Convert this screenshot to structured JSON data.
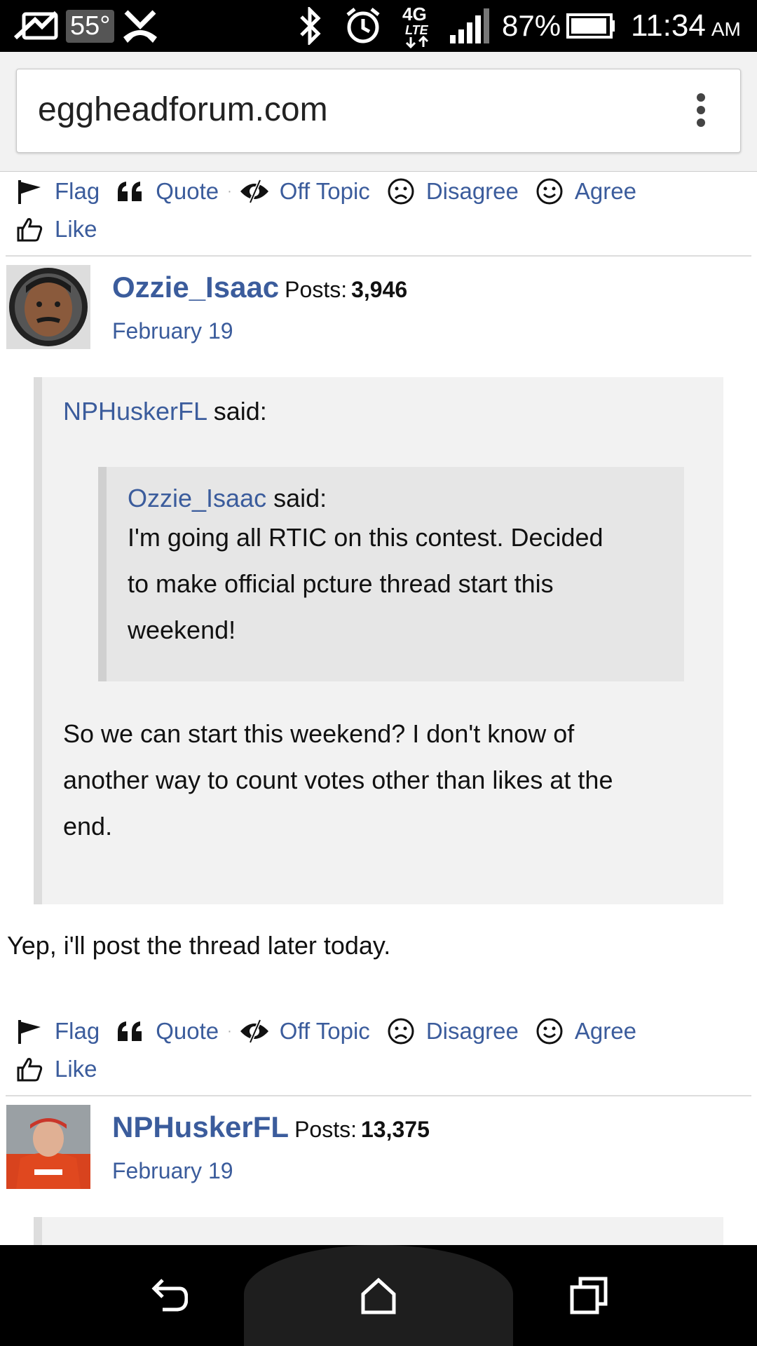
{
  "status_bar": {
    "temperature": "55°",
    "battery_percent": "87%",
    "network": "4G LTE",
    "time": "11:34",
    "ampm": "AM"
  },
  "browser": {
    "url": "eggheadforum.com"
  },
  "actions": {
    "flag": "Flag",
    "quote": "Quote",
    "off_topic": "Off Topic",
    "disagree": "Disagree",
    "agree": "Agree",
    "like": "Like"
  },
  "posts": [
    {
      "author": "Ozzie_Isaac",
      "posts_label": "Posts:",
      "posts_count": "3,946",
      "date": "February 19",
      "quote": {
        "author": "NPHuskerFL",
        "said": "said:",
        "nested": {
          "author": "Ozzie_Isaac",
          "said": "said:",
          "lines": [
            "I'm going all RTIC on this contest.  Decided",
            "to make official pcture thread start this",
            "weekend!"
          ]
        },
        "lines": [
          "So we can start this weekend?  I don't know of",
          "another way to count votes other than likes at the",
          "end."
        ]
      },
      "reply": "Yep, i'll post the thread later today."
    },
    {
      "author": "NPHuskerFL",
      "posts_label": "Posts:",
      "posts_count": "13,375",
      "date": "February 19"
    }
  ],
  "icons": {
    "flag": "flag-icon",
    "quote": "quote-icon",
    "off_topic": "eye-off-icon",
    "disagree": "frown-icon",
    "agree": "smile-icon",
    "like": "thumbs-up-icon",
    "back": "back-icon",
    "home": "home-icon",
    "recents": "recents-icon"
  }
}
